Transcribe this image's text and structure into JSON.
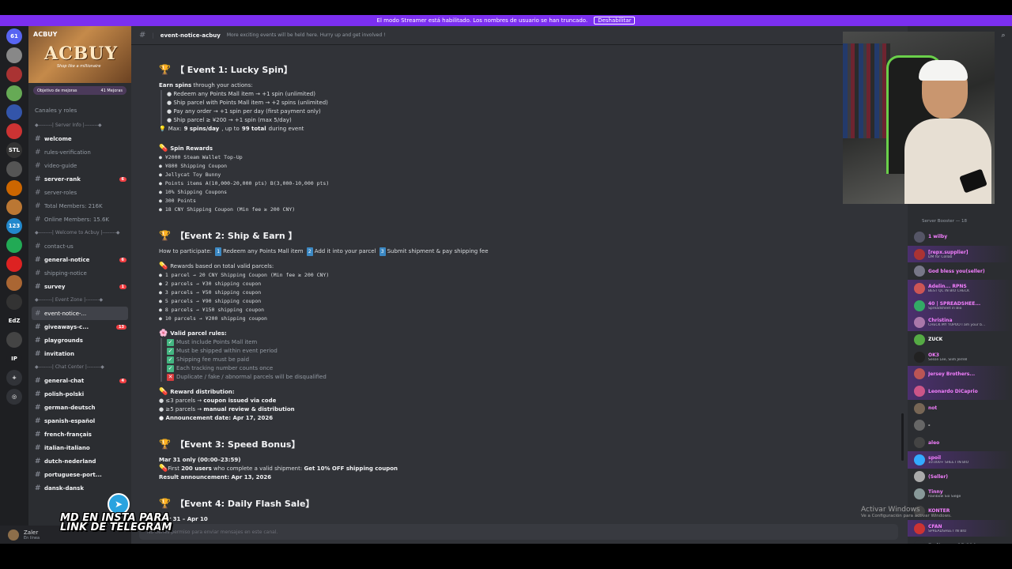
{
  "banner": {
    "text": "El modo Streamer está habilitado. Los nombres de usuario se han truncado.",
    "button": "Deshabilitar"
  },
  "guilds": [
    {
      "label": "61",
      "color": "#5865f2"
    },
    {
      "label": "",
      "color": "#888"
    },
    {
      "label": "",
      "color": "#a33"
    },
    {
      "label": "",
      "color": "#6a5"
    },
    {
      "label": "",
      "color": "#35a"
    },
    {
      "label": "",
      "color": "#c33"
    },
    {
      "label": "STL",
      "color": "#333"
    },
    {
      "label": "",
      "color": "#555"
    },
    {
      "label": "",
      "color": "#c60"
    },
    {
      "label": "",
      "color": "#b73"
    },
    {
      "label": "123",
      "color": "#28c"
    },
    {
      "label": "",
      "color": "#2a5"
    },
    {
      "label": "",
      "color": "#d22"
    },
    {
      "label": "",
      "color": "#a63"
    },
    {
      "label": "",
      "color": "#333"
    },
    {
      "label": "EdZ",
      "color": "#1e1f22"
    },
    {
      "label": "",
      "color": "#444"
    },
    {
      "label": "IP",
      "color": "#1e1f22"
    },
    {
      "label": "+",
      "color": "#313338"
    },
    {
      "label": "◎",
      "color": "#313338"
    }
  ],
  "server": {
    "name": "ACBUY",
    "logo": "ACBUY",
    "tagline": "Shop like a millionaire",
    "boost_goal": "Objetivo de mejoras",
    "boost_count": "41 Mejoras",
    "channels_roles": "Canales y roles"
  },
  "channels": [
    {
      "type": "cat",
      "name": "◆--------| Server Info |--------◆"
    },
    {
      "type": "ch",
      "name": "welcome",
      "bold": true
    },
    {
      "type": "ch",
      "name": "rules-verification"
    },
    {
      "type": "ch",
      "name": "video-guide"
    },
    {
      "type": "ch",
      "name": "server-rank",
      "bold": true,
      "badge": "6"
    },
    {
      "type": "ch",
      "name": "server-roles"
    },
    {
      "type": "ch",
      "name": "Total Members: 216K"
    },
    {
      "type": "ch",
      "name": "Online Members: 15.6K"
    },
    {
      "type": "cat",
      "name": "◆--------| Welcome to Acbuy |--------◆"
    },
    {
      "type": "ch",
      "name": "contact-us"
    },
    {
      "type": "ch",
      "name": "general-notice",
      "bold": true,
      "badge": "6"
    },
    {
      "type": "ch",
      "name": "shipping-notice"
    },
    {
      "type": "ch",
      "name": "survey",
      "bold": true,
      "badge": "1"
    },
    {
      "type": "cat",
      "name": "◆--------| Event Zone |--------◆"
    },
    {
      "type": "ch",
      "name": "event-notice-...",
      "active": true
    },
    {
      "type": "ch",
      "name": "giveaways-c...",
      "bold": true,
      "badge": "13"
    },
    {
      "type": "ch",
      "name": "playgrounds",
      "bold": true
    },
    {
      "type": "ch",
      "name": "invitation",
      "bold": true
    },
    {
      "type": "cat",
      "name": "◆--------| Chat Center |--------◆"
    },
    {
      "type": "ch",
      "name": "general-chat",
      "bold": true,
      "badge": "4"
    },
    {
      "type": "ch",
      "name": "polish-polski",
      "bold": true
    },
    {
      "type": "ch",
      "name": "german-deutsch",
      "bold": true
    },
    {
      "type": "ch",
      "name": "spanish-español",
      "bold": true
    },
    {
      "type": "ch",
      "name": "french-français",
      "bold": true
    },
    {
      "type": "ch",
      "name": "italian-italiano",
      "bold": true
    },
    {
      "type": "ch",
      "name": "dutch-nederland",
      "bold": true
    },
    {
      "type": "ch",
      "name": "portuguese-port...",
      "bold": true
    },
    {
      "type": "ch",
      "name": "dansk-dansk",
      "bold": true
    }
  ],
  "user": {
    "name": "Zaler",
    "status": "En línea"
  },
  "header": {
    "channel": "event-notice-acbuy",
    "topic": "More exciting events will be held here. Hurry up and get involved !"
  },
  "event1": {
    "title": "【 Event 1: Lucky Spin】",
    "earn_bold": "Earn spins",
    "earn_rest": " through your actions:",
    "actions": [
      "● Redeem any Points Mall item → +1 spin (unlimited)",
      "● Ship parcel with Points Mall item → +2 spins (unlimited)",
      "● Pay any order → +1 spin per day (first payment only)",
      "● Ship parcel ≥ ¥200 → +1 spin (max 5/day)"
    ],
    "max_prefix": "Max: ",
    "max_spins": "9 spins/day",
    "max_mid": ", up to ",
    "max_total": "99 total",
    "max_suffix": " during event",
    "rewards_title": "Spin Rewards",
    "rewards": [
      "● ¥2000 Steam Wallet Top-Up",
      "● ¥800 Shipping Coupon",
      "● Jellycat Toy Bunny",
      "● Points items A(10,000-20,000 pts)  B(3,000-10,000 pts)",
      "● 10% Shipping Coupons",
      "● 300 Points",
      "● 18 CNY Shipping Coupon (Min fee ≥ 200 CNY)"
    ]
  },
  "event2": {
    "title": "【Event 2: Ship & Earn 】",
    "how": "How to participate:",
    "steps": [
      "1",
      "Redeem any Points Mall item",
      "2",
      "Add it into your parcel",
      "3",
      "Submit shipment & pay shipping fee"
    ],
    "rewards_title": "Rewards based on total valid parcels:",
    "rewards": [
      "● 1 parcel →  20 CNY Shipping Coupon (Min fee ≥ 200 CNY)",
      "● 2 parcels → ¥30 shipping coupon",
      "● 3 parcels → ¥50 shipping coupon",
      "● 5 parcels → ¥90 shipping coupon",
      "● 8 parcels → ¥150 shipping coupon",
      "● 10 parcels → ¥200 shipping coupon"
    ],
    "rules_title": "Valid parcel rules:",
    "rules": [
      "Must include Points Mall item",
      "Must be shipped within event period",
      "Shipping fee must be paid",
      "Each tracking number counts once"
    ],
    "disq": "Duplicate / fake / abnormal parcels will be disqualified",
    "dist_title": "Reward distribution:",
    "dist1_pre": "● ≤3 parcels → ",
    "dist1_b": "coupon issued via code",
    "dist2_pre": "● ≥5 parcels → ",
    "dist2_b": "manual review & distribution",
    "announce": "● Announcement date: Apr 17, 2026"
  },
  "event3": {
    "title": "【Event 3: Speed Bonus】",
    "date": "Mar 31 only (00:00–23:59)",
    "first_pre": "First ",
    "first_b": "200 users",
    "first_mid": " who complete a valid shipment: ",
    "first_b2": "Get 10% OFF shipping coupon",
    "result": "Result announcement: Apr 13, 2026"
  },
  "event4": {
    "title": "【Event 4: Daily Flash Sale】",
    "date": "Mar 31 – Apr 10"
  },
  "input_placeholder": "No tienes permiso para enviar mensajes en este canal.",
  "members": {
    "header": "Server Booster — 18",
    "list": [
      {
        "name": "1 wilby",
        "status": "",
        "color": "#f47fff",
        "av": "#556"
      },
      {
        "name": "[repx.supplier]",
        "status": "DM for Collab",
        "color": "#f47fff",
        "av": "#a33",
        "hl": true
      },
      {
        "name": "God bless you(seller)",
        "status": "",
        "color": "#f47fff",
        "av": "#778"
      },
      {
        "name": "Adelin... RPNS",
        "status": "BEST QC IN BIO CHECK",
        "color": "#f47fff",
        "av": "#c55",
        "hl": true
      },
      {
        "name": "40 | SPREADSHEE...",
        "status": "Spreadsheet in Bio",
        "color": "#f47fff",
        "av": "#3a6",
        "hl": true
      },
      {
        "name": "Christina",
        "status": "CHECK MY YUPOO I am your b...",
        "color": "#f47fff",
        "av": "#a7a",
        "hl": true
      },
      {
        "name": "ZUCK",
        "status": "",
        "color": "#fff",
        "av": "#5a4"
      },
      {
        "name": "OK3",
        "status": "Sesse Lee, Slim Jerrell",
        "color": "#f47fff",
        "av": "#222"
      },
      {
        "name": "Jersey Brothers...",
        "status": "",
        "color": "#f47fff",
        "av": "#b55",
        "hl": true
      },
      {
        "name": "Leonardo DiCaprio",
        "status": "",
        "color": "#f47fff",
        "av": "#c58",
        "hl": true
      },
      {
        "name": "not",
        "status": "",
        "color": "#f47fff",
        "av": "#765"
      },
      {
        "name": "-",
        "status": "",
        "color": "#fff",
        "av": "#666"
      },
      {
        "name": "aleo",
        "status": "",
        "color": "#f47fff",
        "av": "#444"
      },
      {
        "name": "spoil",
        "status": "10.000+ SHEET IN BIO",
        "color": "#f47fff",
        "av": "#3af",
        "hl": true
      },
      {
        "name": "(Seller)",
        "status": "",
        "color": "#f47fff",
        "av": "#aaa"
      },
      {
        "name": "Tinny",
        "status": "Rainbow Six Siege",
        "color": "#f47fff",
        "av": "#899"
      },
      {
        "name": "KONTER",
        "status": "",
        "color": "#f47fff",
        "av": "#444"
      },
      {
        "name": "CFAN",
        "status": "SPREADSHEET IN BIO",
        "color": "#f47fff",
        "av": "#c33",
        "hl": true
      },
      {
        "name": "En línea — 15,894",
        "status": "",
        "color": "#949ba4",
        "av": "#2b2d31"
      }
    ]
  },
  "windows": {
    "title": "Activar Windows",
    "sub": "Ve a Configuración para activar Windows."
  },
  "overlay": {
    "line1": "MD EN INSTA PARA",
    "line2": "LINK DE TELEGRAM"
  }
}
